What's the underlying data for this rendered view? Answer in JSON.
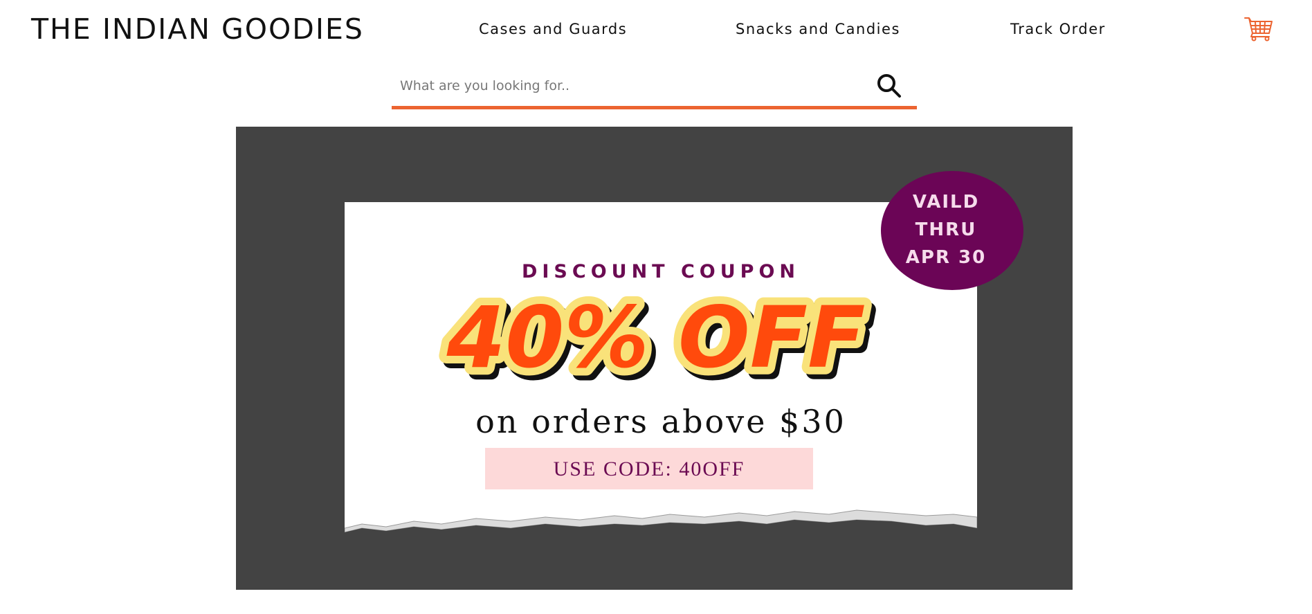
{
  "header": {
    "brand": "THE INDIAN GOODIES",
    "nav": [
      {
        "label": "Cases and Guards"
      },
      {
        "label": "Snacks and Candies"
      },
      {
        "label": "Track Order"
      }
    ],
    "cart_icon": "shopping-cart-icon"
  },
  "search": {
    "placeholder": "What are you looking for..",
    "value": "",
    "icon": "search-icon",
    "accent_color": "#ec6431"
  },
  "banner": {
    "heading": "DISCOUNT COUPON",
    "offer": "40% OFF",
    "subtext": "on orders above $30",
    "code": "USE CODE: 40OFF",
    "validity": {
      "line1": "VAILD",
      "line2": "THRU",
      "line3": "APR 30"
    },
    "colors": {
      "background": "#434343",
      "coupon": "#ffffff",
      "offer_fill": "#ff4a0c",
      "offer_outline": "#f9e27a",
      "heading": "#6b0b52",
      "badge": "#6b0556",
      "code_box": "#fdd9d9"
    }
  }
}
